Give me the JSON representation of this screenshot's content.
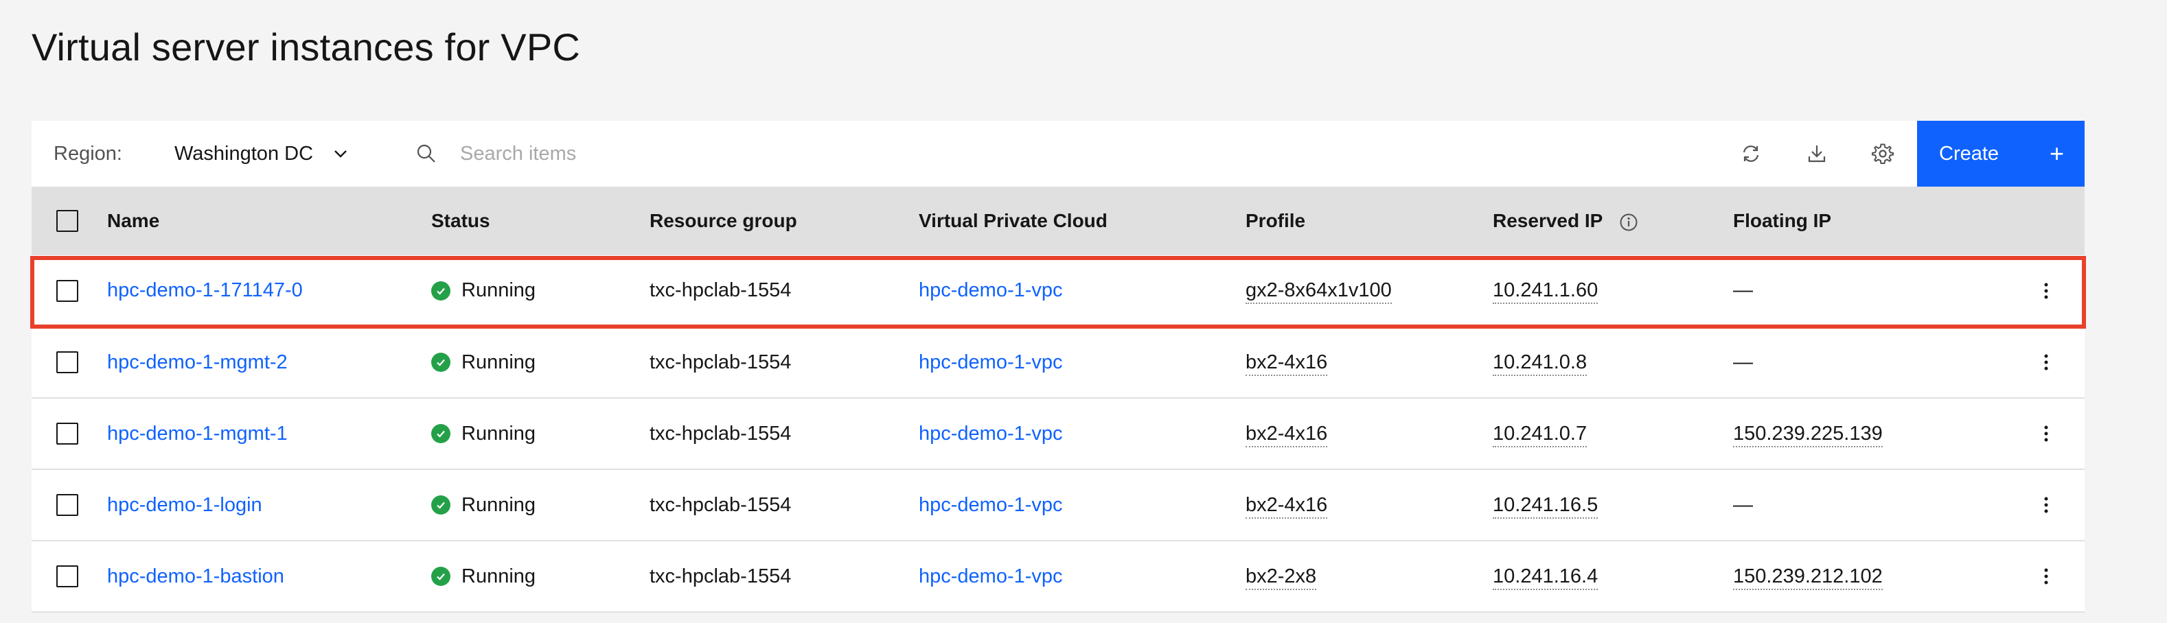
{
  "page_title": "Virtual server instances for VPC",
  "toolbar": {
    "region_label": "Region:",
    "region_value": "Washington DC",
    "search_placeholder": "Search items",
    "refresh_icon": "refresh-icon",
    "download_icon": "download-icon",
    "settings_icon": "gear-icon",
    "create_label": "Create",
    "create_icon": "+"
  },
  "columns": {
    "name": "Name",
    "status": "Status",
    "resource_group": "Resource group",
    "vpc": "Virtual Private Cloud",
    "profile": "Profile",
    "reserved_ip": "Reserved IP",
    "floating_ip": "Floating IP"
  },
  "rows": [
    {
      "name": "hpc-demo-1-171147-0",
      "status": "Running",
      "resource_group": "txc-hpclab-1554",
      "vpc": "hpc-demo-1-vpc",
      "profile": "gx2-8x64x1v100",
      "reserved_ip": "10.241.1.60",
      "floating_ip": "—"
    },
    {
      "name": "hpc-demo-1-mgmt-2",
      "status": "Running",
      "resource_group": "txc-hpclab-1554",
      "vpc": "hpc-demo-1-vpc",
      "profile": "bx2-4x16",
      "reserved_ip": "10.241.0.8",
      "floating_ip": "—"
    },
    {
      "name": "hpc-demo-1-mgmt-1",
      "status": "Running",
      "resource_group": "txc-hpclab-1554",
      "vpc": "hpc-demo-1-vpc",
      "profile": "bx2-4x16",
      "reserved_ip": "10.241.0.7",
      "floating_ip": "150.239.225.139"
    },
    {
      "name": "hpc-demo-1-login",
      "status": "Running",
      "resource_group": "txc-hpclab-1554",
      "vpc": "hpc-demo-1-vpc",
      "profile": "bx2-4x16",
      "reserved_ip": "10.241.16.5",
      "floating_ip": "—"
    },
    {
      "name": "hpc-demo-1-bastion",
      "status": "Running",
      "resource_group": "txc-hpclab-1554",
      "vpc": "hpc-demo-1-vpc",
      "profile": "bx2-2x8",
      "reserved_ip": "10.241.16.4",
      "floating_ip": "150.239.212.102"
    }
  ],
  "colors": {
    "accent": "#0f62fe",
    "status_running": "#24a148",
    "highlight": "#e8402a"
  }
}
